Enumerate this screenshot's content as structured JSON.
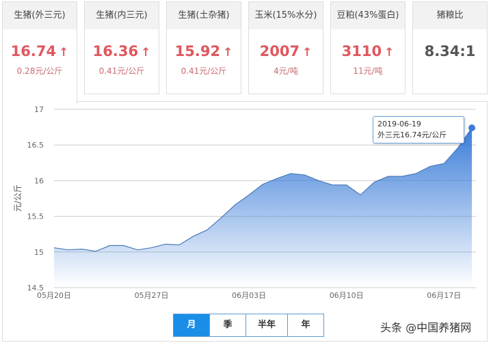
{
  "cards": [
    {
      "title": "生猪(外三元)",
      "value": "16.74",
      "arrow": "↑",
      "change": "0.28元/公斤"
    },
    {
      "title": "生猪(内三元)",
      "value": "16.36",
      "arrow": "↑",
      "change": "0.41元/公斤"
    },
    {
      "title": "生猪(土杂猪)",
      "value": "15.92",
      "arrow": "↑",
      "change": "0.41元/公斤"
    },
    {
      "title": "玉米(15%水分)",
      "value": "2007",
      "arrow": "↑",
      "change": "4元/吨"
    },
    {
      "title": "豆粕(43%蛋白)",
      "value": "3110",
      "arrow": "↑",
      "change": "11元/吨"
    },
    {
      "title": "猪粮比",
      "value": "8.34:1"
    }
  ],
  "tooltip": {
    "date": "2019-06-19",
    "text": "外三元16.74元/公斤"
  },
  "buttons": [
    "月",
    "季",
    "半年",
    "年"
  ],
  "watermark": "头条 @中国养猪网",
  "colors": {
    "accent": "#1a8ee6",
    "up": "#e0575f",
    "line": "#3b7dd8"
  },
  "chart_data": {
    "type": "area",
    "ylabel": "元/公斤",
    "ylim": [
      14.5,
      17
    ],
    "yticks": [
      "14.5",
      "15",
      "15.5",
      "16",
      "16.5",
      "17"
    ],
    "xticks": [
      {
        "label": "05月20日",
        "index": 0
      },
      {
        "label": "05月27日",
        "index": 7
      },
      {
        "label": "06月03日",
        "index": 14
      },
      {
        "label": "06月10日",
        "index": 21
      },
      {
        "label": "06月17日",
        "index": 28
      }
    ],
    "values": [
      15.06,
      15.03,
      15.04,
      15.01,
      15.09,
      15.09,
      15.03,
      15.06,
      15.11,
      15.1,
      15.22,
      15.31,
      15.48,
      15.66,
      15.8,
      15.95,
      16.03,
      16.1,
      16.08,
      16.0,
      15.94,
      15.94,
      15.8,
      15.98,
      16.06,
      16.06,
      16.1,
      16.2,
      16.24,
      16.46,
      16.74
    ]
  }
}
